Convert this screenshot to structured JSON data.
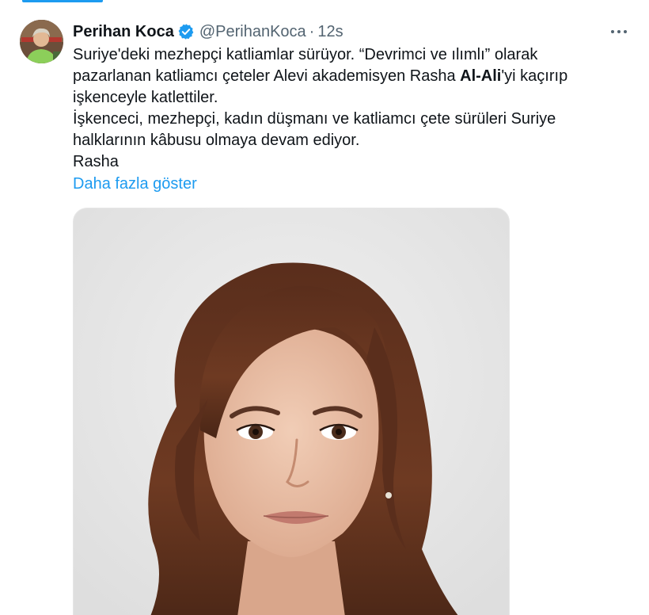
{
  "tweet": {
    "author": {
      "display_name": "Perihan Koca",
      "handle": "@PerihanKoca",
      "verified": true,
      "avatar_icon": "profile-photo"
    },
    "separator": "·",
    "time": "12s",
    "more_icon": "ellipsis-icon",
    "text_lines": [
      "Suriye'deki mezhepçi katliamlar sürüyor. “Devrimci ve ılımlı” olarak",
      "pazarlanan katliamcı çeteler Alevi akademisyen Rasha ",
      "Al-Ali",
      "'yi kaçırıp",
      "işkenceyle katlettiler.",
      "İşkenceci, mezhepçi, kadın düşmanı ve katliamcı çete sürüleri Suriye",
      "halklarının kâbusu olmaya devam ediyor.",
      "Rasha"
    ],
    "show_more": "Daha fazla göster",
    "media": {
      "kind": "portrait-photo"
    }
  },
  "colors": {
    "accent": "#1d9bf0",
    "text": "#0f1419",
    "secondary": "#536471"
  }
}
